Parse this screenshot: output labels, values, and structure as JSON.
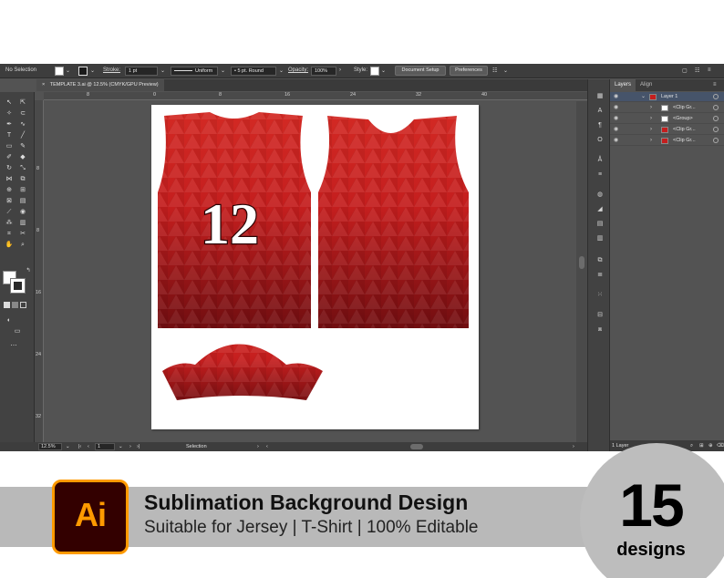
{
  "control_bar": {
    "selection_label": "No Selection",
    "stroke_label": "Stroke:",
    "stroke_weight": "1 pt",
    "profile_label": "Uniform",
    "brush_label": "5 pt. Round",
    "opacity_label": "Opacity:",
    "opacity_value": "100%",
    "style_label": "Style:",
    "document_setup_label": "Document Setup",
    "preferences_label": "Preferences"
  },
  "document_tab": {
    "close_glyph": "×",
    "title": "TEMPLATE 3.ai @ 12.5% (CMYK/GPU Preview)"
  },
  "ruler_top": [
    "0",
    "8",
    "16",
    "24",
    "32",
    "40"
  ],
  "ruler_left": [
    "8",
    "8",
    "16",
    "24",
    "32",
    "40"
  ],
  "tools": [
    "arrow-icon",
    "direct-select-icon",
    "magic-wand-icon",
    "lasso-icon",
    "pen-icon",
    "curvature-icon",
    "type-icon",
    "line-icon",
    "rectangle-icon",
    "paintbrush-icon",
    "shaper-icon",
    "eraser-icon",
    "rotate-icon",
    "scale-icon",
    "width-icon",
    "free-transform-icon",
    "shape-builder-icon",
    "perspective-icon",
    "mesh-icon",
    "gradient-icon",
    "eyedropper-icon",
    "blend-icon",
    "symbol-sprayer-icon",
    "graph-icon",
    "artboard-icon",
    "slice-icon",
    "hand-icon",
    "zoom-icon"
  ],
  "artwork": {
    "jersey_number": "12"
  },
  "status_bar": {
    "zoom": "12.5%",
    "artboard_number": "1",
    "mode": "Selection"
  },
  "layers_panel": {
    "tabs": [
      "Layers",
      "Align"
    ],
    "rows": [
      {
        "name": "Layer 1",
        "indent": 0
      },
      {
        "name": "<Clip Gr...",
        "indent": 1
      },
      {
        "name": "<Group>",
        "indent": 1
      },
      {
        "name": "<Clip Gr...",
        "indent": 1
      },
      {
        "name": "<Clip Gr...",
        "indent": 1
      }
    ],
    "layer_count": "1 Layer"
  },
  "banner": {
    "app_badge": "Ai",
    "title": "Sublimation Background Design",
    "subtitle": "Suitable for Jersey | T-Shirt | 100% Editable",
    "count": "15",
    "count_label": "designs"
  },
  "colors": {
    "accent_orange": "#ff9a00",
    "badge_bg": "#330000",
    "jersey_red": "#c41e1e",
    "ui_dark": "#535353"
  }
}
